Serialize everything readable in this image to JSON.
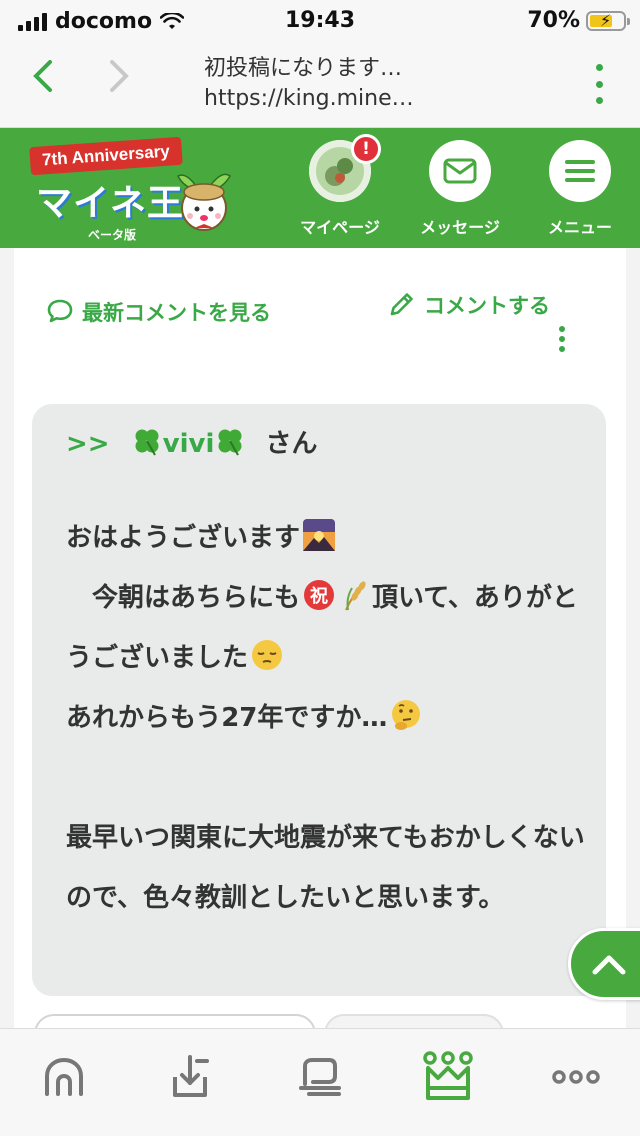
{
  "status_bar": {
    "carrier": "docomo",
    "time": "19:43",
    "battery": "70%",
    "battery_level": 0.7
  },
  "browser": {
    "title": "初投稿になります…",
    "url": "https://king.mine…"
  },
  "header": {
    "logo_banner": "7th Anniversary",
    "logo_text": "マイネ王",
    "logo_sub": "ベータ版",
    "mypage_label": "マイページ",
    "alert_badge": "!",
    "message_label": "メッセージ",
    "menu_label": "メニュー"
  },
  "actions": {
    "latest_comments": "最新コメントを見る",
    "post_comment": "コメントする"
  },
  "comment": {
    "reply_prefix": ">>",
    "reply_name": "vivi",
    "reply_suffix": "さん",
    "line1": "おはようございます",
    "line2a": "　今朝はあちらにも",
    "line2b": "頂いて、ありがとうございました",
    "line3": "あれからもう27年ですか…",
    "line4": "最早いつ関東に大地震が来てもおかしくないので、色々教訓としたいと思います。"
  },
  "icons": {
    "back": "chevron-left-icon",
    "forward": "chevron-right-icon",
    "home": "home-icon",
    "post": "post-icon",
    "chat": "chat-icon",
    "ranking": "crown-icon",
    "more": "more-icon"
  },
  "colors": {
    "brand_green": "#48a93f",
    "accent_green": "#39a846",
    "alert_red": "#e0303a"
  }
}
